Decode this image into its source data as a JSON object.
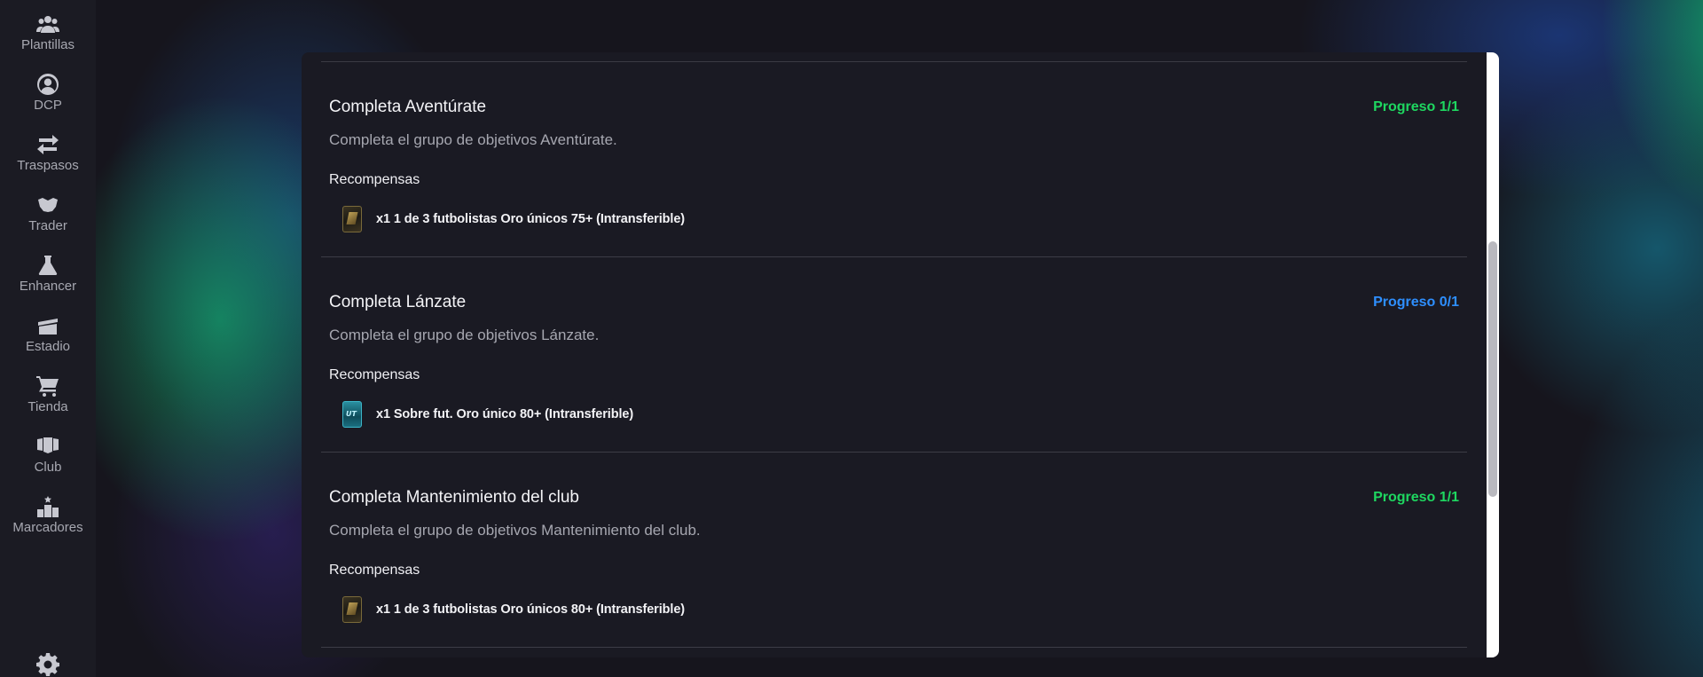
{
  "sidebar": {
    "items": [
      {
        "label": "Plantillas",
        "icon": "users-icon"
      },
      {
        "label": "DCP",
        "icon": "user-circle-icon"
      },
      {
        "label": "Traspasos",
        "icon": "transfer-arrows-icon"
      },
      {
        "label": "Trader",
        "icon": "handshake-icon"
      },
      {
        "label": "Enhancer",
        "icon": "flask-icon"
      },
      {
        "label": "Estadio",
        "icon": "stadium-icon"
      },
      {
        "label": "Tienda",
        "icon": "cart-icon"
      },
      {
        "label": "Club",
        "icon": "club-icon"
      },
      {
        "label": "Marcadores",
        "icon": "podium-icon"
      }
    ],
    "settings_icon": "gear-icon"
  },
  "objectives": [
    {
      "title": "Completa Aventúrate",
      "progress": "Progreso 1/1",
      "progress_color": "#1ed760",
      "description": "Completa el grupo de objetivos Aventúrate.",
      "rewards_label": "Recompensas",
      "reward": "x1 1 de 3 futbolistas Oro únicos 75+ (Intransferible)",
      "reward_icon": "gold-player-pick-icon"
    },
    {
      "title": "Completa Lánzate",
      "progress": "Progreso 0/1",
      "progress_color": "#2e8fff",
      "description": "Completa el grupo de objetivos Lánzate.",
      "rewards_label": "Recompensas",
      "reward": "x1 Sobre fut. Oro único 80+ (Intransferible)",
      "reward_icon": "pack-icon"
    },
    {
      "title": "Completa Mantenimiento del club",
      "progress": "Progreso 1/1",
      "progress_color": "#1ed760",
      "description": "Completa el grupo de objetivos Mantenimiento del club.",
      "rewards_label": "Recompensas",
      "reward": "x1 1 de 3 futbolistas Oro únicos 80+ (Intransferible)",
      "reward_icon": "gold-player-pick-icon"
    }
  ]
}
